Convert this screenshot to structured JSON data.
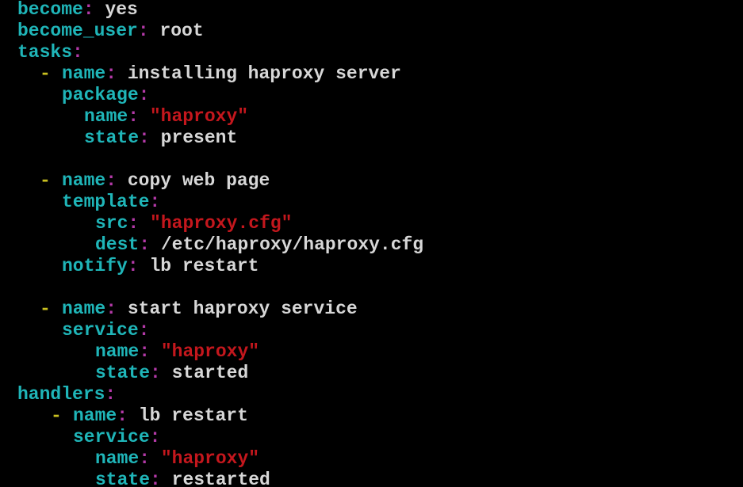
{
  "window": {
    "background": "#000000"
  },
  "colors": {
    "key": "#1fb5b8",
    "colon": "#b43aa8",
    "dash": "#c9c020",
    "plain_value": "#d7d7d7",
    "quoted_string": "#c4171d"
  },
  "editor": {
    "lines": [
      {
        "key": "become",
        "value": "yes",
        "quoted": false
      },
      {
        "key": "become_user",
        "value": "root",
        "quoted": false
      },
      {
        "key": "tasks",
        "value": "",
        "quoted": false
      },
      {
        "dash": "-",
        "key": "name",
        "value": "installing haproxy server",
        "quoted": false
      },
      {
        "key": "package",
        "value": "",
        "quoted": false
      },
      {
        "key": "name",
        "value": "\"haproxy\"",
        "quoted": true
      },
      {
        "key": "state",
        "value": "present",
        "quoted": false
      },
      {
        "dash": "-",
        "key": "name",
        "value": "copy web page",
        "quoted": false
      },
      {
        "key": "template",
        "value": "",
        "quoted": false
      },
      {
        "key": "src",
        "value": "\"haproxy.cfg\"",
        "quoted": true
      },
      {
        "key": "dest",
        "value": "/etc/haproxy/haproxy.cfg",
        "quoted": false
      },
      {
        "key": "notify",
        "value": "lb restart",
        "quoted": false
      },
      {
        "dash": "-",
        "key": "name",
        "value": "start haproxy service",
        "quoted": false
      },
      {
        "key": "service",
        "value": "",
        "quoted": false
      },
      {
        "key": "name",
        "value": "\"haproxy\"",
        "quoted": true
      },
      {
        "key": "state",
        "value": "started",
        "quoted": false
      },
      {
        "key": "handlers",
        "value": "",
        "quoted": false
      },
      {
        "dash": "-",
        "key": "name",
        "value": "lb restart",
        "quoted": false
      },
      {
        "key": "service",
        "value": "",
        "quoted": false
      },
      {
        "key": "name",
        "value": "\"haproxy\"",
        "quoted": true
      },
      {
        "key": "state",
        "value": "restarted",
        "quoted": false
      }
    ]
  }
}
